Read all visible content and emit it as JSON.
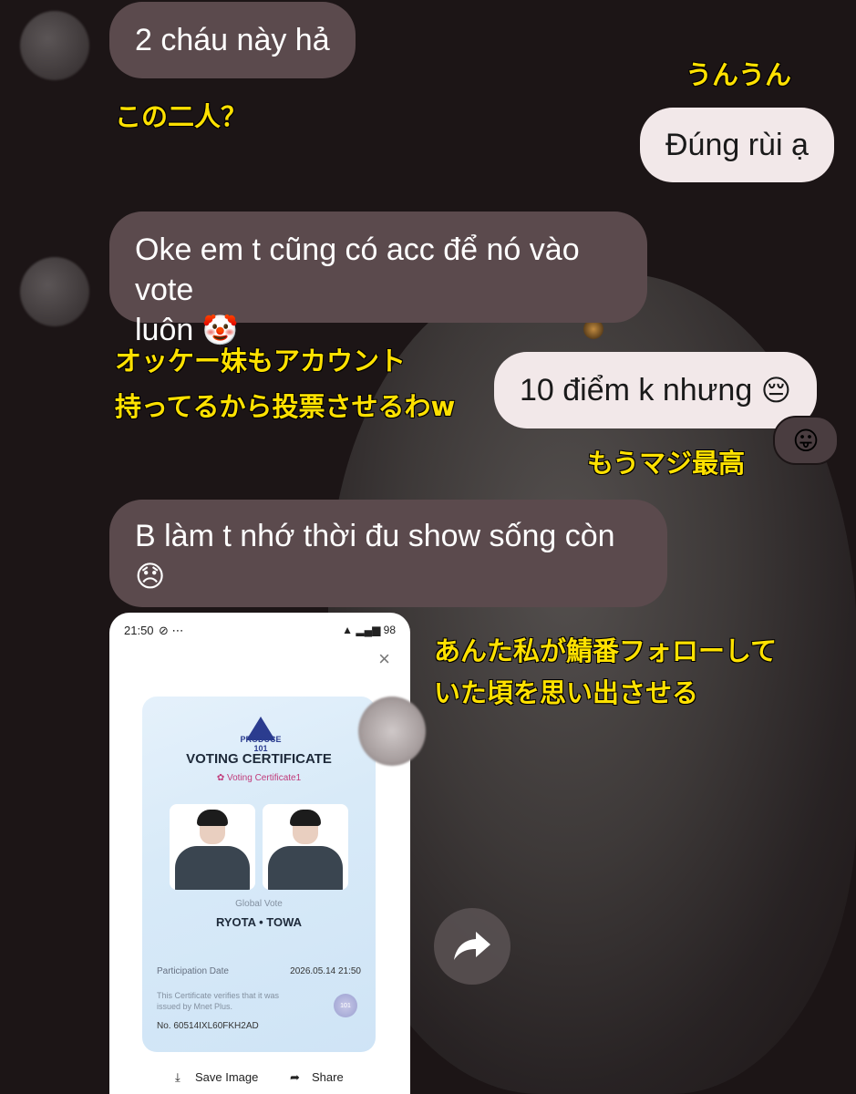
{
  "messages": [
    {
      "text": "2 cháu này hả"
    },
    {
      "text": "Đúng rùi ạ"
    },
    {
      "text": "Oke em t cũng có acc để nó vào vote"
    },
    {
      "text": "luôn"
    },
    {
      "text": "10 điểm k nhưng"
    },
    {
      "text": "B làm t nhớ thời đu show sống còn"
    }
  ],
  "annotations": {
    "uun": "うんうん",
    "two_people": "この二人？",
    "okke_1": "オッケー妹もアカウント",
    "okke_2": "持ってるから投票させるわw",
    "mouma": "もうマジ最高",
    "anta_1": "あんた私が鯖番フォローして",
    "anta_2": "いた頃を思い出させる"
  },
  "emojis": {
    "clown": "🤡",
    "pensive": "😔",
    "tongue": "😛",
    "disappointed": "😞"
  },
  "screenshot": {
    "time": "21:50",
    "status_icons": "⊘ ⋯",
    "battery": "98",
    "close": "×",
    "logo_text": "PRODUCE 101",
    "title": "VOTING CERTIFICATE",
    "subtitle": "Voting Certificate1",
    "vote_type": "Global Vote",
    "names": "RYOTA • TOWA",
    "participation_label": "Participation Date",
    "participation_date": "2026.05.14 21:50",
    "verify_text": "This Certificate verifies that it was issued by Mnet Plus.",
    "seal": "101",
    "number": "No. 60514IXL60FKH2AD",
    "save_image": "Save Image",
    "share": "Share"
  }
}
